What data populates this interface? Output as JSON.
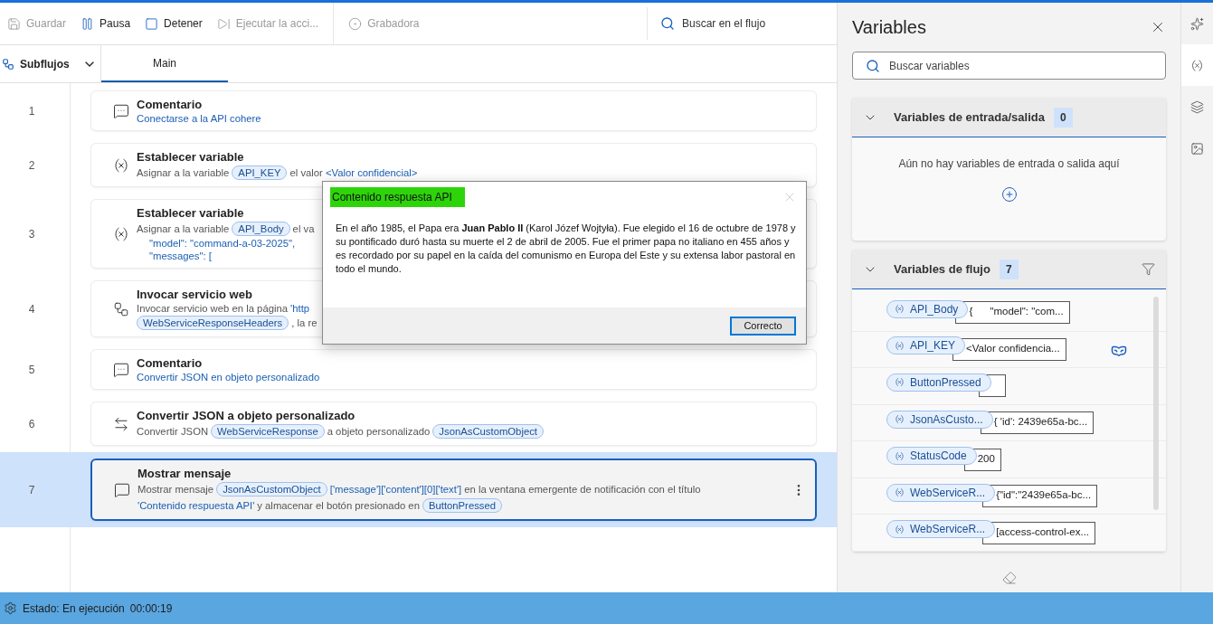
{
  "toolbar": {
    "items": [
      {
        "kind": "save",
        "label": "Guardar",
        "disabled": true
      },
      {
        "kind": "pause",
        "label": "Pausa",
        "disabled": false
      },
      {
        "kind": "stop",
        "label": "Detener",
        "disabled": false
      },
      {
        "kind": "run",
        "label": "Ejecutar la acci...",
        "disabled": true
      },
      {
        "kind": "record",
        "label": "Grabadora",
        "disabled": true
      }
    ],
    "search": {
      "placeholder": "Buscar en el flujo"
    }
  },
  "subflows": {
    "label": "Subflujos"
  },
  "tabs": [
    {
      "label": "Main",
      "selected": true
    }
  ],
  "steps": [
    {
      "number": "1",
      "kind": "comment",
      "title": "Comentario",
      "selected": false,
      "lines": [
        [
          {
            "kind": "link",
            "text": "Conectarse a la API cohere"
          }
        ]
      ]
    },
    {
      "number": "2",
      "kind": "variable",
      "title": "Establecer variable",
      "selected": false,
      "lines": [
        [
          {
            "kind": "text",
            "text": "Asignar a la variable"
          },
          {
            "kind": "var",
            "text": "API_KEY"
          },
          {
            "kind": "text",
            "text": "el valor"
          },
          {
            "kind": "link",
            "text": "<Valor confidencial>"
          }
        ]
      ]
    },
    {
      "number": "3",
      "kind": "variable",
      "title": "Establecer variable",
      "selected": false,
      "lines": [
        [
          {
            "kind": "text",
            "text": "Asignar a la variable"
          },
          {
            "kind": "var",
            "text": "API_Body"
          },
          {
            "kind": "text",
            "text": "el va"
          }
        ],
        [
          {
            "kind": "code",
            "text": "\"model\": \"command-a-03-2025\","
          }
        ],
        [
          {
            "kind": "code",
            "text": "\"messages\": ["
          }
        ]
      ]
    },
    {
      "number": "4",
      "kind": "web",
      "title": "Invocar servicio web",
      "selected": false,
      "lines": [
        [
          {
            "kind": "text",
            "text": "Invocar servicio web en la página"
          },
          {
            "kind": "link",
            "text": "'http"
          }
        ],
        [
          {
            "kind": "var",
            "text": "WebServiceResponseHeaders"
          },
          {
            "kind": "text",
            "text": ", la re"
          }
        ]
      ]
    },
    {
      "number": "5",
      "kind": "comment",
      "title": "Comentario",
      "selected": false,
      "lines": [
        [
          {
            "kind": "link",
            "text": "Convertir JSON en objeto personalizado"
          }
        ]
      ]
    },
    {
      "number": "6",
      "kind": "convert",
      "title": "Convertir JSON a objeto personalizado",
      "selected": false,
      "lines": [
        [
          {
            "kind": "text",
            "text": "Convertir JSON"
          },
          {
            "kind": "var",
            "text": "WebServiceResponse"
          },
          {
            "kind": "text",
            "text": "a objeto personalizado"
          },
          {
            "kind": "var",
            "text": "JsonAsCustomObject"
          }
        ]
      ]
    },
    {
      "number": "7",
      "kind": "message",
      "title": "Mostrar mensaje",
      "selected": true,
      "lines": [
        [
          {
            "kind": "text",
            "text": "Mostrar mensaje"
          },
          {
            "kind": "var",
            "text": "JsonAsCustomObject"
          },
          {
            "kind": "link",
            "text": "['message']['content'][0]['text']"
          },
          {
            "kind": "text",
            "text": "en la ventana emergente de notificación con el título"
          }
        ],
        [
          {
            "kind": "link",
            "text": "'Contenido respuesta API'"
          },
          {
            "kind": "text",
            "text": "y almacenar el botón presionado en"
          },
          {
            "kind": "var",
            "text": "ButtonPressed"
          }
        ]
      ]
    }
  ],
  "dialog": {
    "title": "Contenido respuesta API",
    "title_highlighted": true,
    "message": "En el año 1985, el Papa era **Juan Pablo II** (Karol Józef Wojtyła). Fue elegido el 16 de octubre de 1978 y su pontificado duró hasta su muerte el 2 de abril de 2005. Fue el primer papa no italiano en 455 años y es recordado por su papel en la caída del comunismo en Europa del Este y su extensa labor pastoral en todo el mundo.",
    "button": "Correcto"
  },
  "variables_panel": {
    "title": "Variables",
    "search": {
      "placeholder": "Buscar variables"
    },
    "io_section": {
      "title": "Variables de entrada/salida",
      "count": "0",
      "expanded": true,
      "empty_text": "Aún no hay variables de entrada o salida aquí"
    },
    "flow_section": {
      "title": "Variables de flujo",
      "count": "7",
      "expanded": true,
      "variables": [
        {
          "name": "API_Body",
          "value": "{      \"model\": \"com...",
          "sensitive": false
        },
        {
          "name": "API_KEY",
          "value": "<Valor confidencia...",
          "sensitive": true
        },
        {
          "name": "ButtonPressed",
          "sensitive": false
        },
        {
          "name": "JsonAsCusto...",
          "value": "{ 'id': 2439e65a-bc...",
          "sensitive": false
        },
        {
          "name": "StatusCode",
          "value": "200",
          "sensitive": false
        },
        {
          "name": "WebServiceR...",
          "value": "{\"id\":\"2439e65a-bc...",
          "sensitive": false
        },
        {
          "name": "WebServiceR...",
          "value": "[access-control-ex...",
          "sensitive": false
        }
      ]
    }
  },
  "side_strip": [
    {
      "kind": "copilot",
      "selected": false
    },
    {
      "kind": "variables",
      "selected": true
    },
    {
      "kind": "layers",
      "selected": false
    },
    {
      "kind": "images",
      "selected": false
    }
  ],
  "status_bar": {
    "state": "Estado: En ejecución",
    "time": "00:00:19"
  }
}
